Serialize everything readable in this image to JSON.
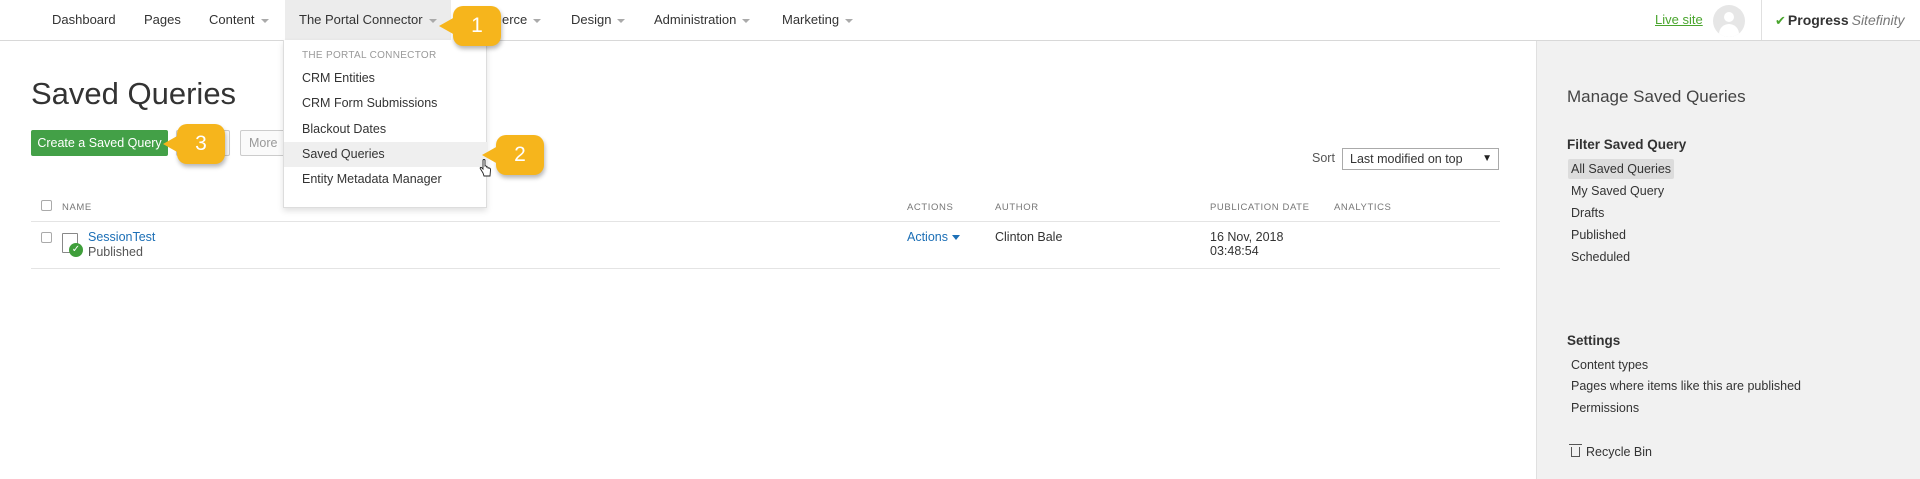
{
  "topnav": {
    "items": [
      {
        "label": "Dashboard",
        "caret": false
      },
      {
        "label": "Pages",
        "caret": false
      },
      {
        "label": "Content",
        "caret": true
      },
      {
        "label": "The Portal Connector",
        "caret": true
      },
      {
        "label": "erce",
        "caret": true
      },
      {
        "label": "Design",
        "caret": true
      },
      {
        "label": "Administration",
        "caret": true
      },
      {
        "label": "Marketing",
        "caret": true
      }
    ],
    "live_site": "Live site",
    "brand": {
      "name": "Progress",
      "product": "Sitefinity"
    }
  },
  "dropdown": {
    "header": "THE PORTAL CONNECTOR",
    "items": [
      "CRM Entities",
      "CRM Form Submissions",
      "Blackout Dates",
      "Saved Queries",
      "Entity Metadata Manager"
    ]
  },
  "main": {
    "title": "Saved Queries",
    "create_button": "Create a Saved Query",
    "more_button": "More",
    "sort": {
      "label": "Sort",
      "selected": "Last modified on top"
    },
    "columns": {
      "name": "NAME",
      "actions": "ACTIONS",
      "author": "AUTHOR",
      "publication_date": "PUBLICATION DATE",
      "analytics": "ANALYTICS"
    },
    "rows": [
      {
        "title": "SessionTest",
        "status": "Published",
        "actions": "Actions",
        "author": "Clinton Bale",
        "date": "16 Nov, 2018",
        "time": "03:48:54"
      }
    ]
  },
  "sidebar": {
    "title": "Manage Saved Queries",
    "filter_heading": "Filter Saved Query",
    "filters": [
      "All Saved Queries",
      "My Saved Query",
      "Drafts",
      "Published",
      "Scheduled"
    ],
    "settings_heading": "Settings",
    "settings": [
      "Content types",
      "Pages where items like this are published",
      "Permissions"
    ],
    "recycle_bin": "Recycle Bin"
  },
  "callouts": [
    "1",
    "2",
    "3"
  ],
  "colors": {
    "accent_green": "#43a047",
    "link_blue": "#1c6fb6",
    "callout_orange": "#f6b51c"
  }
}
